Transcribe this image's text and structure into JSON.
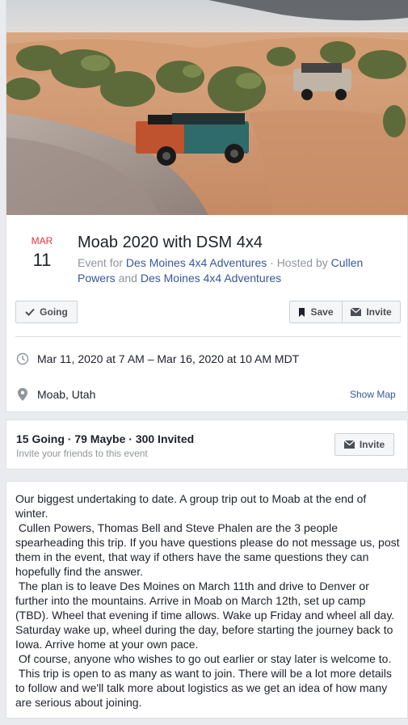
{
  "event": {
    "month": "MAR",
    "day": "11",
    "title": "Moab 2020 with DSM 4x4",
    "event_for_prefix": "Event for ",
    "event_for": "Des Moines 4x4 Adventures",
    "hosted_by_prefix": " · Hosted by ",
    "host1": "Cullen Powers",
    "and": " and ",
    "host2": "Des Moines 4x4 Adventures"
  },
  "actions": {
    "going_label": "Going",
    "save_label": "Save",
    "invite_label": "Invite"
  },
  "details": {
    "datetime": "Mar 11, 2020 at 7 AM – Mar 16, 2020 at 10 AM MDT",
    "location": "Moab, Utah",
    "show_map": "Show Map"
  },
  "guests": {
    "counts": "15 Going · 79 Maybe · 300 Invited",
    "hint": "Invite your friends to this event",
    "invite_label": "Invite"
  },
  "description": [
    "Our biggest undertaking to date. A group trip out to Moab at the end of winter.",
    " Cullen Powers, Thomas Bell and Steve Phalen are the 3 people spearheading this trip. If you have questions please do not message us, post them in the event, that way if others have the same questions they can hopefully find the answer.",
    " The plan is to leave Des Moines on March 11th and drive to Denver or further into the mountains. Arrive in Moab on March 12th, set up camp (TBD). Wheel that evening if time allows. Wake up Friday and wheel all day. Saturday wake up, wheel during the day, before starting the journey back to Iowa. Arrive home at your own pace.",
    " Of course, anyone who wishes to go out earlier or stay later is welcome to.",
    " This trip is open to as many as want to join. There will be a lot more details to follow and we'll talk more about logistics as we get an idea of how many are serious about joining."
  ],
  "colors": {
    "month": "#e9343a",
    "link": "#365899",
    "muted": "#90949c"
  }
}
